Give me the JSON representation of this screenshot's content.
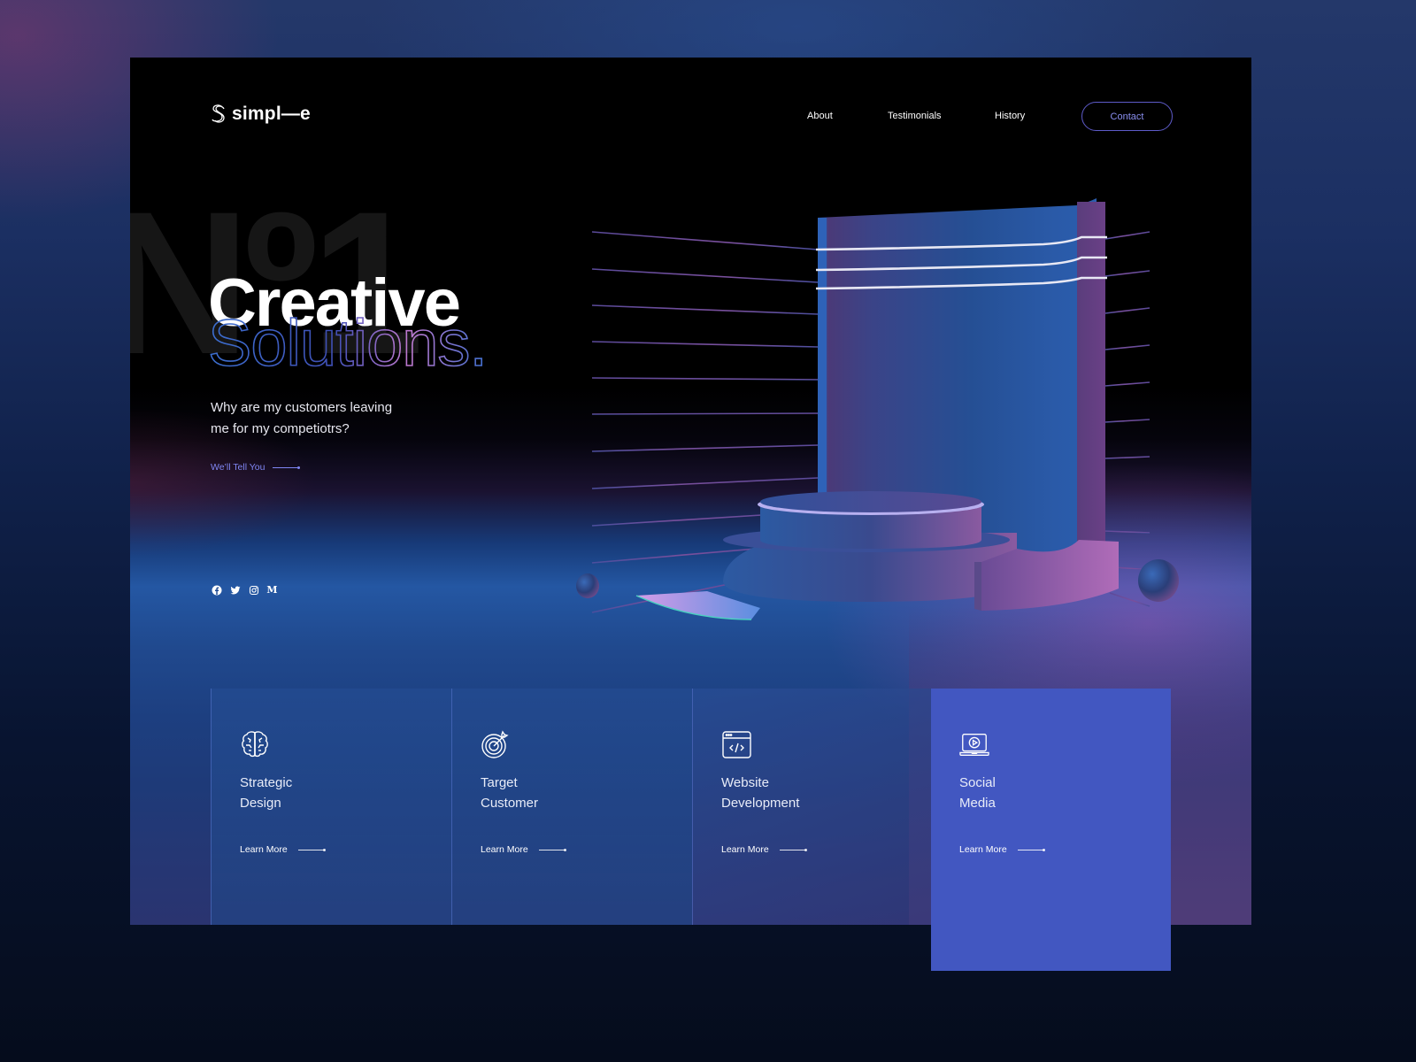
{
  "brand": {
    "name": "simpl—e",
    "logo_icon": "s-monogram-icon"
  },
  "nav": {
    "items": [
      {
        "label": "About"
      },
      {
        "label": "Testimonials"
      },
      {
        "label": "History"
      }
    ],
    "contact_label": "Contact"
  },
  "hero": {
    "backdrop_text": "Nº1",
    "headline_line1": "Creative",
    "headline_line2": "Solutions.",
    "subtitle": "Why are my customers leaving me for my competiotrs?",
    "cta_label": "We’ll Tell You",
    "social_icons": [
      "facebook-icon",
      "twitter-icon",
      "instagram-icon",
      "medium-icon"
    ],
    "medium_glyph": "M"
  },
  "services": [
    {
      "title_line1": "Strategic",
      "title_line2": "Design",
      "link_label": "Learn More",
      "icon": "brain-icon"
    },
    {
      "title_line1": "Target",
      "title_line2": "Customer",
      "link_label": "Learn More",
      "icon": "target-icon"
    },
    {
      "title_line1": "Website",
      "title_line2": "Development",
      "link_label": "Learn More",
      "icon": "code-window-icon"
    },
    {
      "title_line1": "Social",
      "title_line2": "Media",
      "link_label": "Learn More",
      "icon": "laptop-play-icon"
    }
  ],
  "colors": {
    "accent": "#4257c1",
    "link": "#7f86f2",
    "contact_border": "#5e5bc9",
    "backdrop_number": "#161616"
  }
}
